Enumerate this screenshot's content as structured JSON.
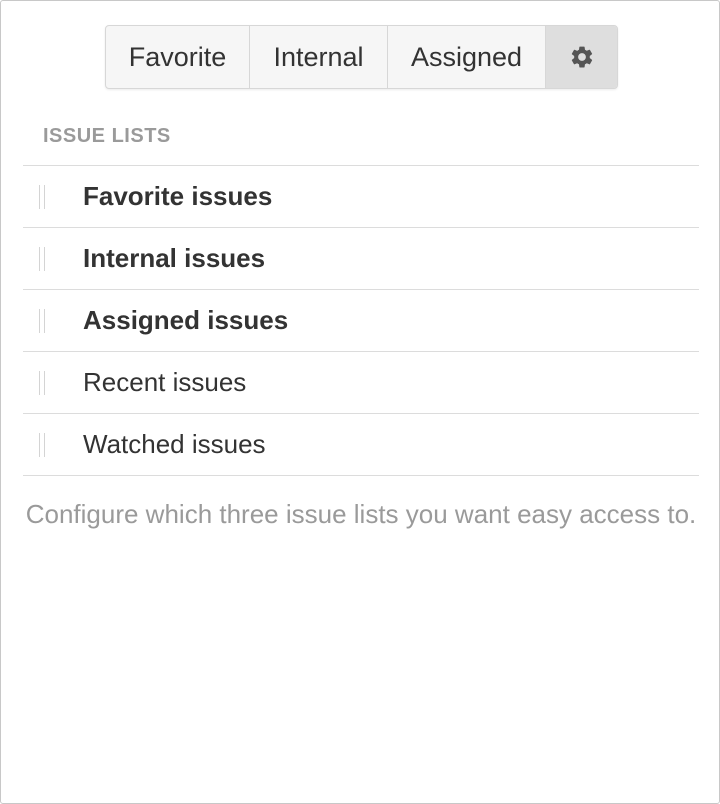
{
  "tabs": [
    {
      "label": "Favorite"
    },
    {
      "label": "Internal"
    },
    {
      "label": "Assigned"
    }
  ],
  "settings_icon": "gear-icon",
  "section": {
    "label": "ISSUE LISTS"
  },
  "issue_lists": [
    {
      "label": "Favorite issues",
      "selected": true
    },
    {
      "label": "Internal issues",
      "selected": true
    },
    {
      "label": "Assigned issues",
      "selected": true
    },
    {
      "label": "Recent issues",
      "selected": false
    },
    {
      "label": "Watched issues",
      "selected": false
    }
  ],
  "help_text": "Configure which three issue lists you want easy access to.",
  "colors": {
    "text": "#333333",
    "muted": "#9a9a9a",
    "active_tab_bg": "#dedede",
    "tab_bg": "#f6f6f6"
  }
}
